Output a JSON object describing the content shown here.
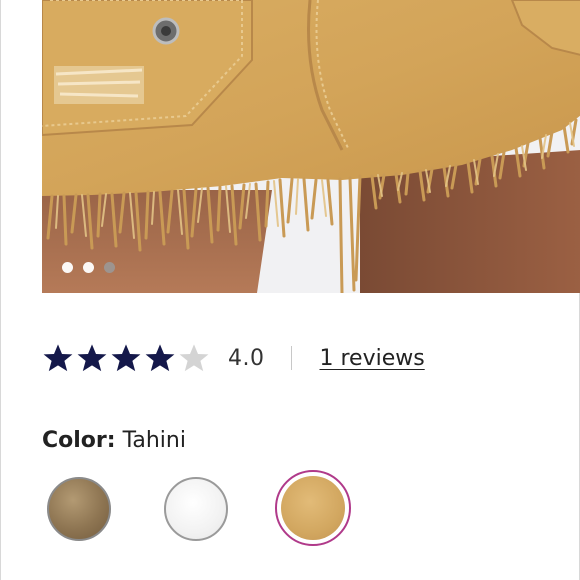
{
  "gallery": {
    "image_alt": "Frayed hem distressed denim mini skirt in Tahini",
    "dots": [
      {
        "state": "active"
      },
      {
        "state": "active"
      },
      {
        "state": "inactive"
      }
    ]
  },
  "rating": {
    "stars_filled": 4,
    "stars_total": 5,
    "star_color": "#14184a",
    "star_empty_color": "#d4d4d4",
    "value": "4.0",
    "reviews_link": "1 reviews"
  },
  "color": {
    "label": "Color:",
    "selected": "Tahini",
    "swatches": [
      {
        "name": "swatch-1",
        "color": "#8e7552",
        "selected": false
      },
      {
        "name": "swatch-2",
        "color": "#f2f2f2",
        "selected": false
      },
      {
        "name": "swatch-tahini",
        "color": "#d2a760",
        "selected": true
      }
    ],
    "selected_ring_color": "#b03a8a"
  }
}
